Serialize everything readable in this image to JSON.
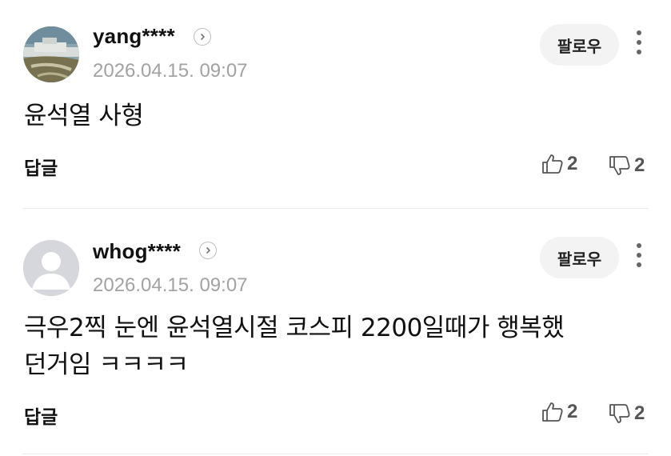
{
  "comments": [
    {
      "username": "yang****",
      "timestamp": "2026.04.15. 09:07",
      "follow_label": "팔로우",
      "body": "윤석열 사형",
      "reply_label": "답글",
      "likes": "2",
      "dislikes": "2",
      "avatar": "landscape-photo"
    },
    {
      "username": "whog****",
      "timestamp": "2026.04.15. 09:07",
      "follow_label": "팔로우",
      "body": "극우2찍 눈엔 윤석열시절 코스피 2200일때가 행복했\n던거임 ㅋㅋㅋㅋ",
      "reply_label": "답글",
      "likes": "2",
      "dislikes": "2",
      "avatar": "default-person"
    }
  ],
  "icons": {
    "profile_link": "chevron-right-circle-icon",
    "more": "vertical-dots-icon",
    "like": "thumbs-up-icon",
    "dislike": "thumbs-down-icon"
  },
  "colors": {
    "timestamp": "#a2a2a2",
    "follow_bg": "#f3f3f4",
    "divider": "#ececec"
  }
}
